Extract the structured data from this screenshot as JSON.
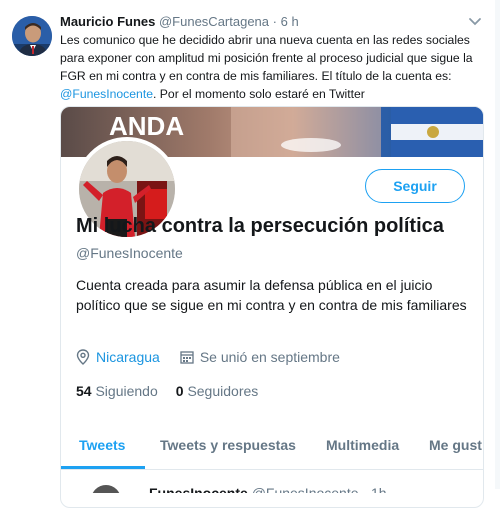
{
  "tweet": {
    "author_name": "Mauricio Funes",
    "author_handle": "@FunesCartagena",
    "time": "6 h",
    "separator": "·",
    "text_before_mention": "Les comunico que he decidido abrir una nueva cuenta en las redes sociales para exponer con amplitud mi posición frente al proceso judicial que sigue la FGR en mi contra y en contra de mis familiares. El título de la cuenta es: ",
    "mention": "@FunesInocente",
    "text_after_mention": ". Por el momento solo estaré en Twitter"
  },
  "profile_card": {
    "follow_label": "Seguir",
    "name": "Mi lucha contra la persecución política",
    "handle": "@FunesInocente",
    "bio": "Cuenta creada para asumir la defensa pública en el juicio político que se sigue en mi contra y en contra de mis familiares",
    "location": "Nicaragua",
    "joined": "Se unió en septiembre",
    "following_count": "54",
    "following_label": "Siguiendo",
    "followers_count": "0",
    "followers_label": "Seguidores",
    "banner_text": "ANDA",
    "tabs": [
      {
        "label": "Tweets"
      },
      {
        "label": "Tweets y respuestas"
      },
      {
        "label": "Multimedia"
      },
      {
        "label": "Me gust"
      }
    ],
    "next_tweet": {
      "name": "FunesInocente",
      "handle": "@FunesInocente · 1h"
    }
  },
  "colors": {
    "accent": "#1da1f2",
    "link": "#1b95e0",
    "muted": "#657786"
  },
  "icons": [
    "chevron-down-icon",
    "location-pin-icon",
    "calendar-icon"
  ]
}
